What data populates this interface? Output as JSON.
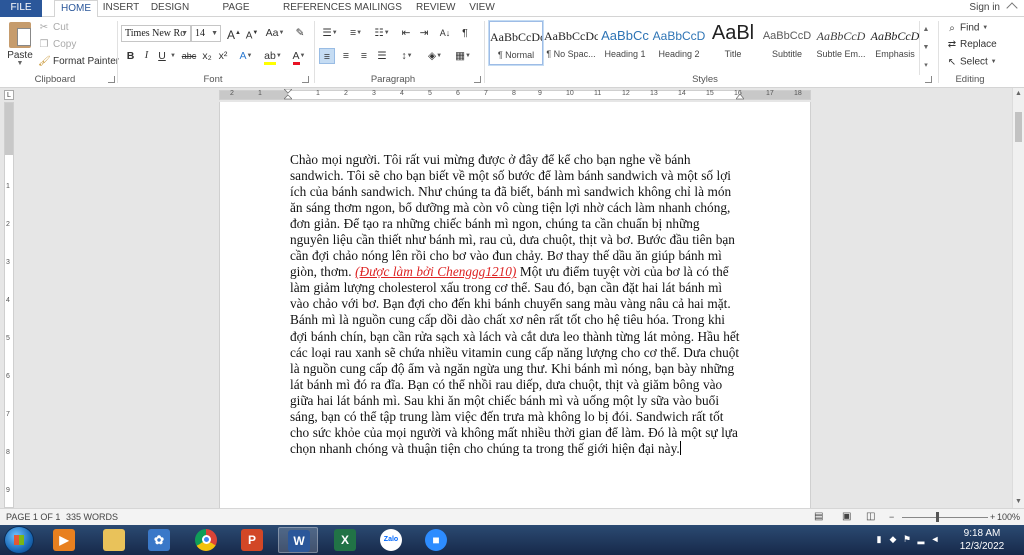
{
  "tabs": {
    "file": "FILE",
    "home": "HOME",
    "insert": "INSERT",
    "design": "DESIGN",
    "page_layout": "PAGE LAYOUT",
    "references": "REFERENCES",
    "mailings": "MAILINGS",
    "review": "REVIEW",
    "view": "VIEW",
    "sign_in": "Sign in"
  },
  "clipboard": {
    "paste": "Paste",
    "cut": "Cut",
    "copy": "Copy",
    "format_painter": "Format Painter",
    "label": "Clipboard"
  },
  "font": {
    "name": "Times New Ro",
    "size": "14",
    "grow": "A",
    "shrink": "A",
    "case": "Aa",
    "bold": "B",
    "italic": "I",
    "underline": "U",
    "strikethrough": "abc",
    "subscript": "x₂",
    "superscript": "x²",
    "label": "Font"
  },
  "paragraph": {
    "label": "Paragraph",
    "pilcrow": "¶",
    "sort": "A↓"
  },
  "styles": {
    "label": "Styles",
    "items": [
      {
        "sample": "AaBbCcDc",
        "name": "¶ Normal"
      },
      {
        "sample": "AaBbCcDc",
        "name": "¶ No Spac..."
      },
      {
        "sample": "AaBbCc",
        "name": "Heading 1"
      },
      {
        "sample": "AaBbCcD",
        "name": "Heading 2"
      },
      {
        "sample": "AaBl",
        "name": "Title"
      },
      {
        "sample": "AaBbCcD",
        "name": "Subtitle"
      },
      {
        "sample": "AaBbCcD",
        "name": "Subtle Em..."
      },
      {
        "sample": "AaBbCcD",
        "name": "Emphasis"
      }
    ]
  },
  "editing": {
    "find": "Find",
    "replace": "Replace",
    "select": "Select",
    "label": "Editing"
  },
  "ruler": {
    "corner": "L",
    "h_numbers": [
      "2",
      "1",
      "1",
      "2",
      "3",
      "4",
      "5",
      "6",
      "7",
      "8",
      "9",
      "10",
      "11",
      "12",
      "13",
      "14",
      "15",
      "16",
      "17",
      "18"
    ],
    "v_numbers": [
      "1",
      "2",
      "3",
      "4",
      "5",
      "6",
      "7",
      "8",
      "9"
    ]
  },
  "document": {
    "before_credit": "Chào mọi người. Tôi rất vui mừng được ở đây để kể cho bạn nghe về bánh sandwich. Tôi sẽ cho bạn biết về một số bước để làm bánh sandwich và một số lợi ích của bánh sandwich. Như chúng ta đã biết, bánh mì sandwich không chỉ là món ăn sáng thơm ngon, bổ dưỡng mà còn vô cùng tiện lợi nhờ cách làm nhanh chóng, đơn giản. Để tạo ra những chiếc bánh mì ngon, chúng ta cần chuẩn bị những nguyên liệu cần thiết như bánh mì, rau củ, dưa chuột, thịt và bơ. Bước đầu tiên bạn cần đợi chảo nóng lên rồi cho bơ vào đun chảy. Bơ thay thế dầu ăn giúp bánh mì giòn, thơm. ",
    "credit": "(Được làm bởi Chenggg1210)",
    "after_credit": " Một ưu điểm tuyệt vời của bơ là có thể làm giảm lượng cholesterol xấu trong cơ thể. Sau đó, bạn cần đặt hai lát bánh mì vào chảo với bơ. Bạn đợi cho đến khi bánh chuyển sang màu vàng nâu cả hai mặt. Bánh mì là nguồn cung cấp dồi dào chất xơ nên rất tốt cho hệ tiêu hóa. Trong khi đợi bánh chín, bạn cần rửa sạch xà lách và cắt dưa leo thành từng lát mỏng. Hầu hết các loại rau xanh sẽ chứa nhiều vitamin cung cấp năng lượng cho cơ thể. Dưa chuột là nguồn cung cấp độ ẩm và ngăn ngừa ung thư. Khi bánh mì nóng, bạn bày những lát bánh mì đó ra đĩa. Bạn có thể nhồi rau diếp, dưa chuột, thịt và giăm bông vào giữa hai lát bánh mì. Sau khi ăn một chiếc bánh mì và uống một ly sữa vào buổi sáng, bạn có thể tập trung làm việc đến trưa mà không lo bị đói. Sandwich rất tốt cho sức khỏe của mọi người và không mất nhiều thời gian để làm. Đó là một sự lựa chọn nhanh chóng và thuận tiện cho chúng ta trong thế giới hiện đại này."
  },
  "status": {
    "page": "PAGE 1 OF 1",
    "words": "335 WORDS",
    "zoom": "100%"
  },
  "taskbar": {
    "word_letter": "W",
    "excel_letter": "X",
    "ppt_letter": "P",
    "zalo_label": "Zalo",
    "time": "9:18 AM",
    "date": "12/3/2022"
  },
  "colors": {
    "accent": "#2b579a",
    "credit": "#d22222",
    "word": "#2b579a",
    "excel": "#217346",
    "powerpoint": "#d24726"
  }
}
